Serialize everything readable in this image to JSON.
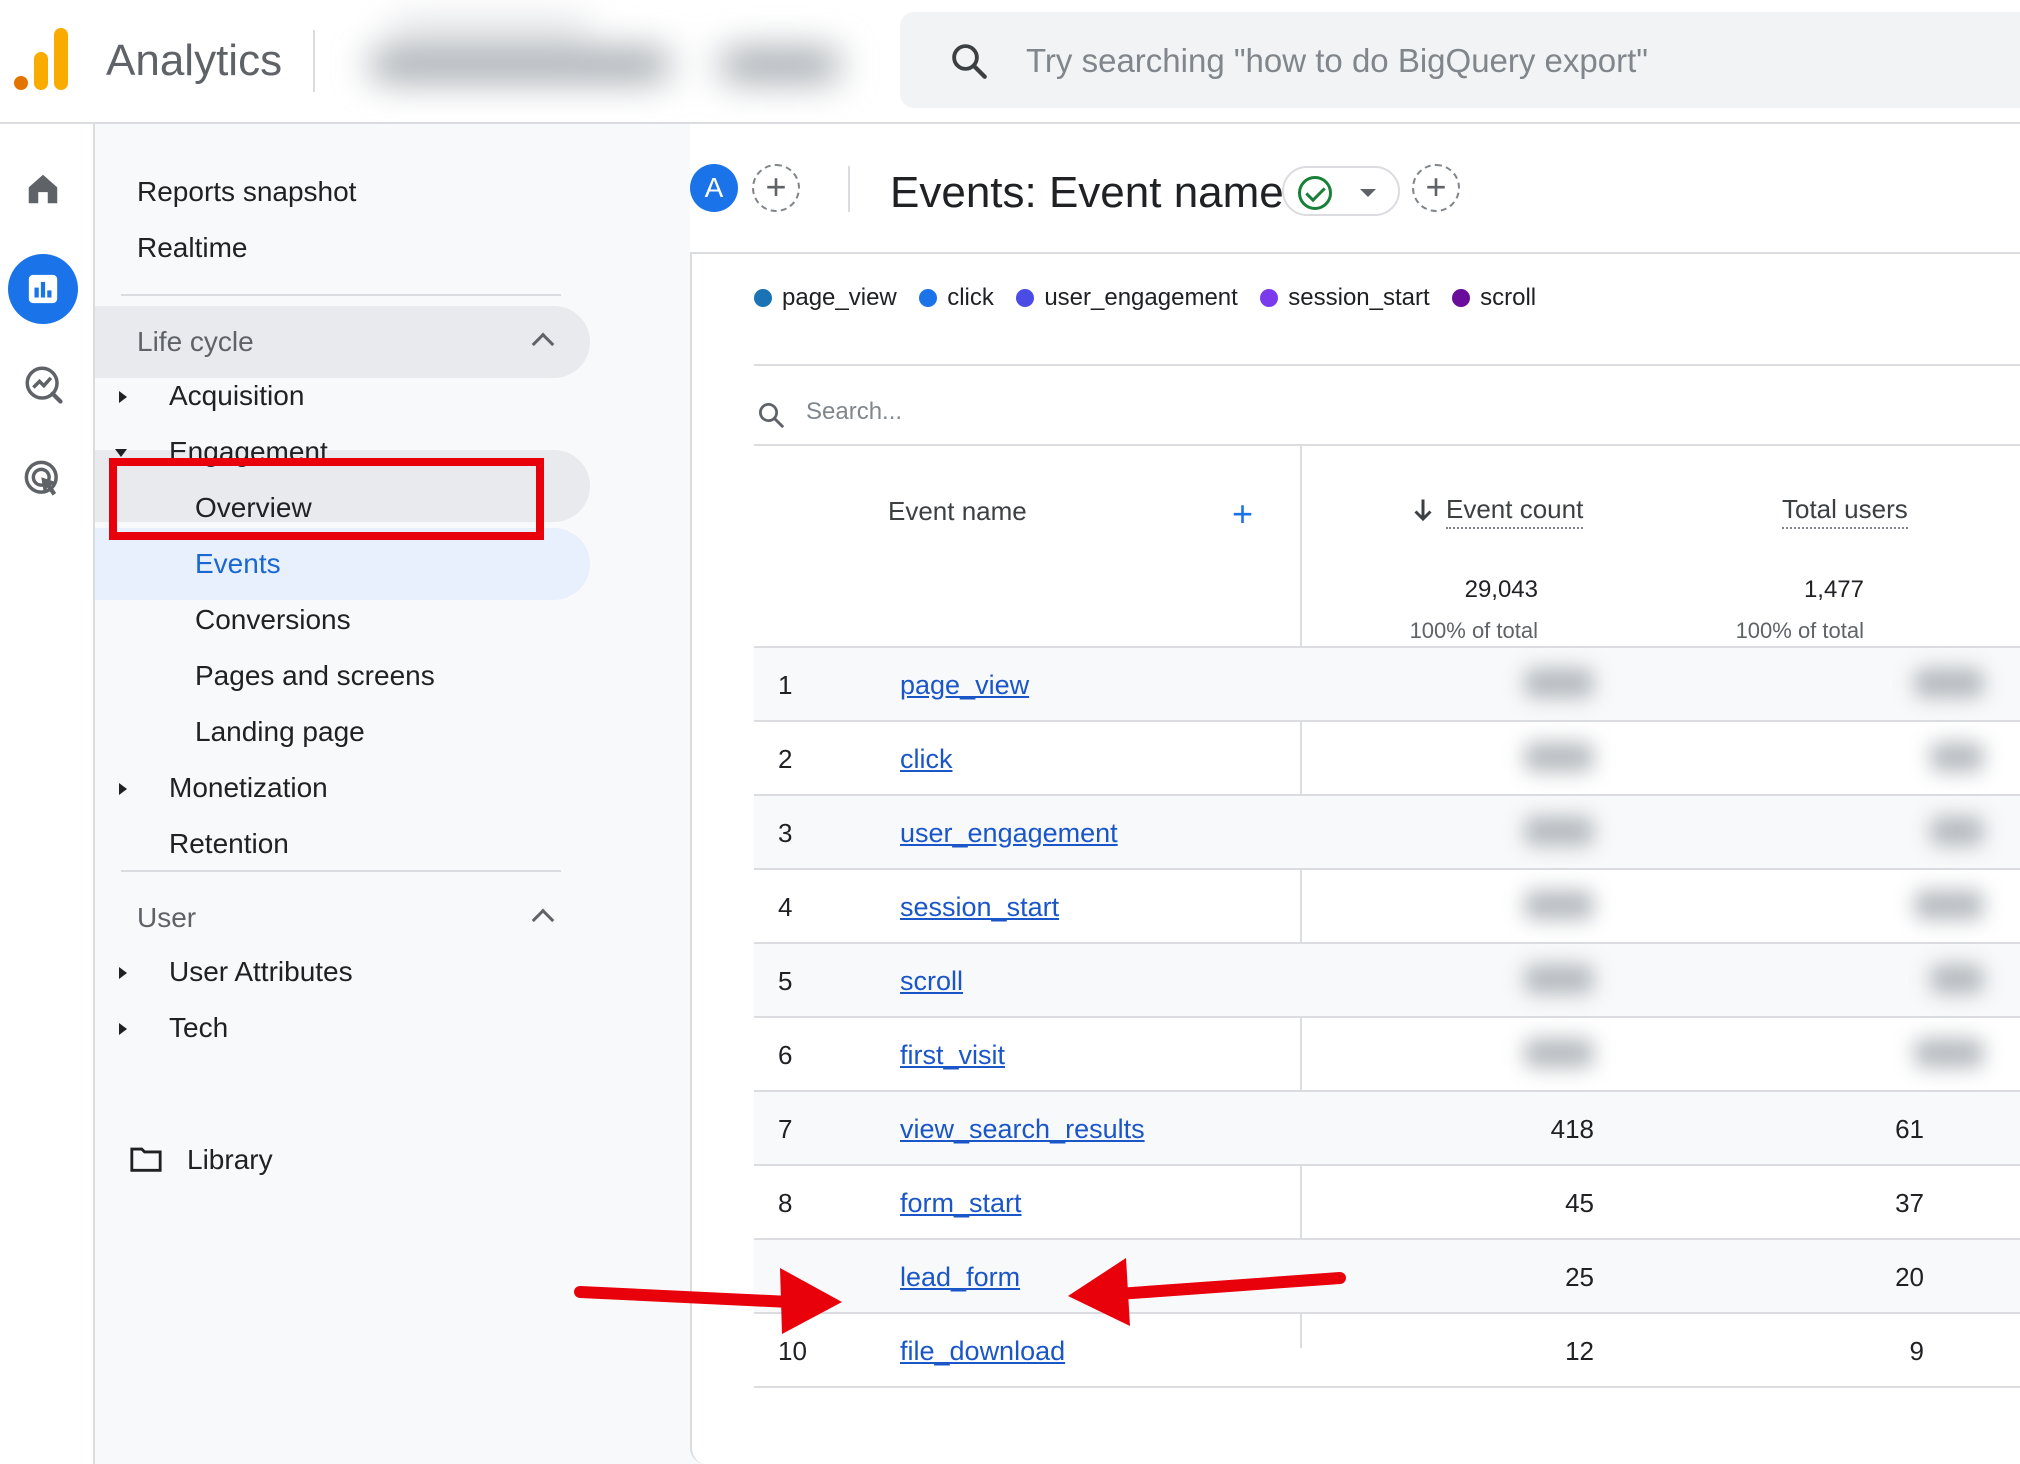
{
  "app": {
    "title": "Analytics"
  },
  "search": {
    "placeholder": "Try searching \"how to do BigQuery export\""
  },
  "rail": {
    "items": [
      {
        "icon": "home-icon"
      },
      {
        "icon": "reports-icon",
        "active": true
      },
      {
        "icon": "explore-icon"
      },
      {
        "icon": "advertising-icon"
      }
    ]
  },
  "sidebar": {
    "reports_snapshot": "Reports snapshot",
    "realtime": "Realtime",
    "lifecycle": {
      "label": "Life cycle",
      "acquisition": "Acquisition",
      "engagement": "Engagement",
      "overview": "Overview",
      "events": "Events",
      "conversions": "Conversions",
      "pages_and_screens": "Pages and screens",
      "landing_page": "Landing page",
      "monetization": "Monetization",
      "retention": "Retention"
    },
    "user": {
      "label": "User",
      "attributes": "User Attributes",
      "tech": "Tech"
    },
    "library": "Library"
  },
  "header": {
    "avatar": "A",
    "title": "Events: Event name"
  },
  "legend": [
    {
      "label": "page_view",
      "color": "#1a73b5"
    },
    {
      "label": "click",
      "color": "#1a73e8"
    },
    {
      "label": "user_engagement",
      "color": "#4b4ce6"
    },
    {
      "label": "session_start",
      "color": "#7c3aed"
    },
    {
      "label": "scroll",
      "color": "#6a0d9b"
    }
  ],
  "table": {
    "search_placeholder": "Search...",
    "columns": {
      "event_name": "Event name",
      "event_count": "Event count",
      "total_users": "Total users"
    },
    "totals": {
      "event_count": "29,043",
      "event_count_pct": "100% of total",
      "total_users": "1,477",
      "total_users_pct": "100% of total"
    },
    "rows": [
      {
        "idx": "1",
        "name": "page_view",
        "event_count": "",
        "total_users": ""
      },
      {
        "idx": "2",
        "name": "click",
        "event_count": "",
        "total_users": ""
      },
      {
        "idx": "3",
        "name": "user_engagement",
        "event_count": "",
        "total_users": ""
      },
      {
        "idx": "4",
        "name": "session_start",
        "event_count": "",
        "total_users": ""
      },
      {
        "idx": "5",
        "name": "scroll",
        "event_count": "",
        "total_users": ""
      },
      {
        "idx": "6",
        "name": "first_visit",
        "event_count": "",
        "total_users": ""
      },
      {
        "idx": "7",
        "name": "view_search_results",
        "event_count": "418",
        "total_users": "61"
      },
      {
        "idx": "8",
        "name": "form_start",
        "event_count": "45",
        "total_users": "37"
      },
      {
        "idx": "",
        "name": "lead_form",
        "event_count": "25",
        "total_users": "20"
      },
      {
        "idx": "10",
        "name": "file_download",
        "event_count": "12",
        "total_users": "9"
      }
    ]
  }
}
